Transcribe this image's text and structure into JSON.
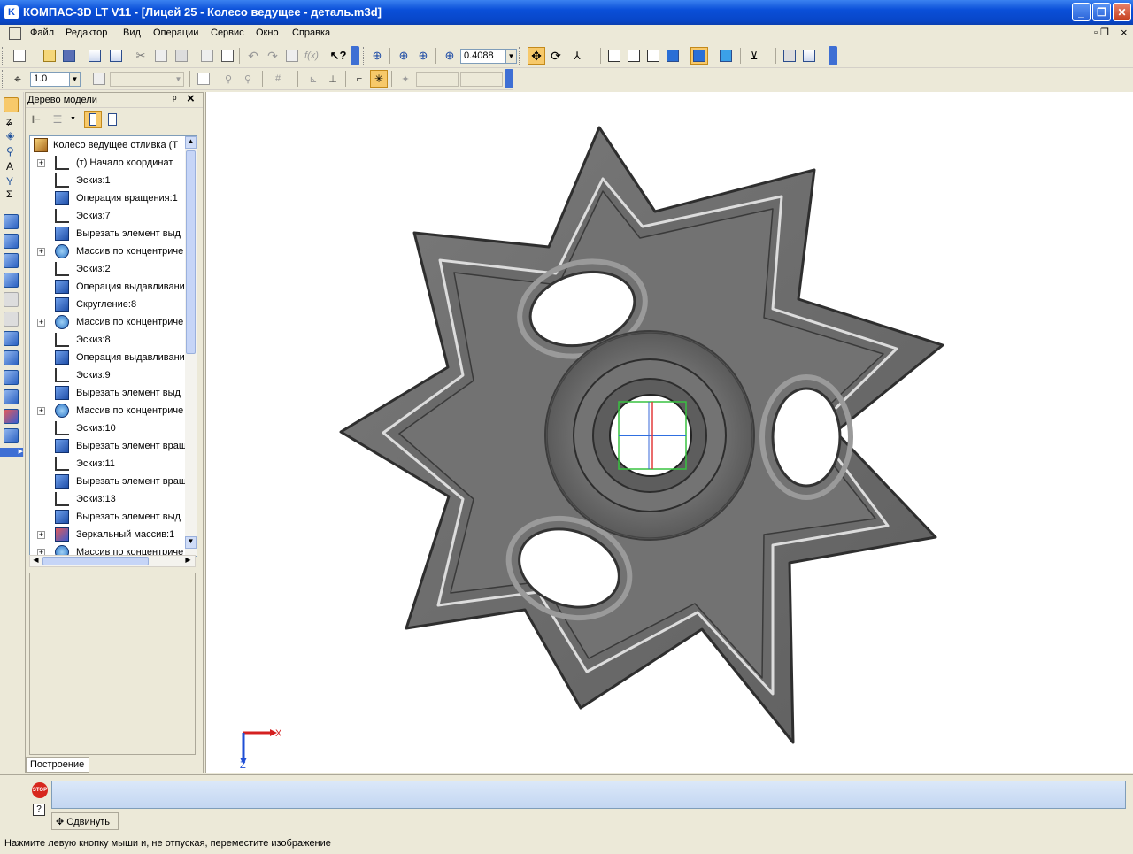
{
  "window": {
    "app_icon_glyph": "K",
    "title": "КОМПАС-3D LT V11 - [Лицей 25 - Колесо ведущее - деталь.m3d]",
    "minimize_glyph": "_",
    "maximize_glyph": "❐",
    "close_glyph": "✕"
  },
  "menu": {
    "items": [
      "Файл",
      "Редактор",
      "Вид",
      "Операции",
      "Сервис",
      "Окно",
      "Справка"
    ],
    "restore_glyph": "▫ ❐",
    "close_glyph": "×"
  },
  "toolbar": {
    "zoom_value": "0.4088",
    "step_value": "1.0"
  },
  "tree": {
    "header": "Дерево модели",
    "pin_glyph": "ᵖ",
    "close_glyph": "×",
    "tab_label": "Построение",
    "root": "Колесо ведущее отливка (Т",
    "items": [
      {
        "label": "(т) Начало координат",
        "icon": "origin-icon",
        "expandable": true
      },
      {
        "label": "Эскиз:1",
        "icon": "sketch-icon",
        "expandable": false
      },
      {
        "label": "Операция вращения:1",
        "icon": "rotation-op-icon",
        "expandable": false
      },
      {
        "label": "Эскиз:7",
        "icon": "sketch-icon",
        "expandable": false
      },
      {
        "label": "Вырезать элемент выд",
        "icon": "cut-extrude-icon",
        "expandable": false
      },
      {
        "label": "Массив по концентриче",
        "icon": "circular-array-icon",
        "expandable": true
      },
      {
        "label": "Эскиз:2",
        "icon": "sketch-icon",
        "expandable": false
      },
      {
        "label": "Операция выдавливани",
        "icon": "extrude-op-icon",
        "expandable": false
      },
      {
        "label": "Скругление:8",
        "icon": "fillet-icon",
        "expandable": false
      },
      {
        "label": "Массив по концентриче",
        "icon": "circular-array-icon",
        "expandable": true
      },
      {
        "label": "Эскиз:8",
        "icon": "sketch-icon",
        "expandable": false
      },
      {
        "label": "Операция выдавливани",
        "icon": "extrude-op-icon",
        "expandable": false
      },
      {
        "label": "Эскиз:9",
        "icon": "sketch-icon",
        "expandable": false
      },
      {
        "label": "Вырезать элемент выд",
        "icon": "cut-extrude-icon",
        "expandable": false
      },
      {
        "label": "Массив по концентриче",
        "icon": "circular-array-icon",
        "expandable": true
      },
      {
        "label": "Эскиз:10",
        "icon": "sketch-icon",
        "expandable": false
      },
      {
        "label": "Вырезать элемент вращ",
        "icon": "cut-rotation-icon",
        "expandable": false
      },
      {
        "label": "Эскиз:11",
        "icon": "sketch-icon",
        "expandable": false
      },
      {
        "label": "Вырезать элемент вращ",
        "icon": "cut-rotation-icon",
        "expandable": false
      },
      {
        "label": "Эскиз:13",
        "icon": "sketch-icon",
        "expandable": false
      },
      {
        "label": "Вырезать элемент выд",
        "icon": "cut-extrude-icon",
        "expandable": false
      },
      {
        "label": "Зеркальный массив:1",
        "icon": "mirror-array-icon",
        "expandable": true
      },
      {
        "label": "Массив по концентриче",
        "icon": "circular-array-icon",
        "expandable": true
      }
    ]
  },
  "axes": {
    "x": "X",
    "z": "Z"
  },
  "panel": {
    "stop_label": "STOP",
    "help_glyph": "?",
    "move_button": "Сдвинуть",
    "move_glyph": "✥"
  },
  "status": {
    "hint": "Нажмите левую кнопку мыши и, не отпуская, переместите изображение"
  },
  "colors": {
    "title_bar": "#0a4fd8",
    "chrome": "#ece9d8",
    "part_fill": "#6e6e6e",
    "viewport_bg": "#ffffff"
  }
}
